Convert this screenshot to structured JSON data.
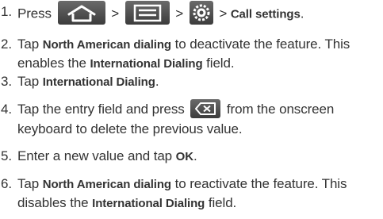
{
  "steps": [
    {
      "num": "1.",
      "sep1": ">",
      "sep2": ">",
      "sep3": ">",
      "bold": "Call settings",
      "tail": "."
    },
    {
      "num": "2.",
      "pre": "Tap ",
      "bold1": "North American dialing",
      "mid": " to deactivate the feature. This enables the ",
      "bold2": "International Dialing",
      "post": " field."
    },
    {
      "num": "3.",
      "pre": "Tap ",
      "bold1": "International Dialing",
      "post": "."
    },
    {
      "num": "4.",
      "pre": "Tap the entry field and press ",
      "post": " from the onscreen keyboard to delete the previous value."
    },
    {
      "num": "5.",
      "pre": "Enter a new value and tap ",
      "bold1": "OK",
      "post": "."
    },
    {
      "num": "6.",
      "pre": "Tap ",
      "bold1": "North American dialing",
      "mid": " to reactivate the feature. This disables the ",
      "bold2": "International Dialing",
      "post": " field."
    }
  ],
  "icons": {
    "step1": [
      "home-icon",
      "menu-icon",
      "settings-icon"
    ],
    "step4": [
      "delete-key-icon"
    ]
  },
  "colors": {
    "text": "#333333",
    "icon_bg": "#4a4a4a",
    "icon_fg": "#ffffff"
  }
}
